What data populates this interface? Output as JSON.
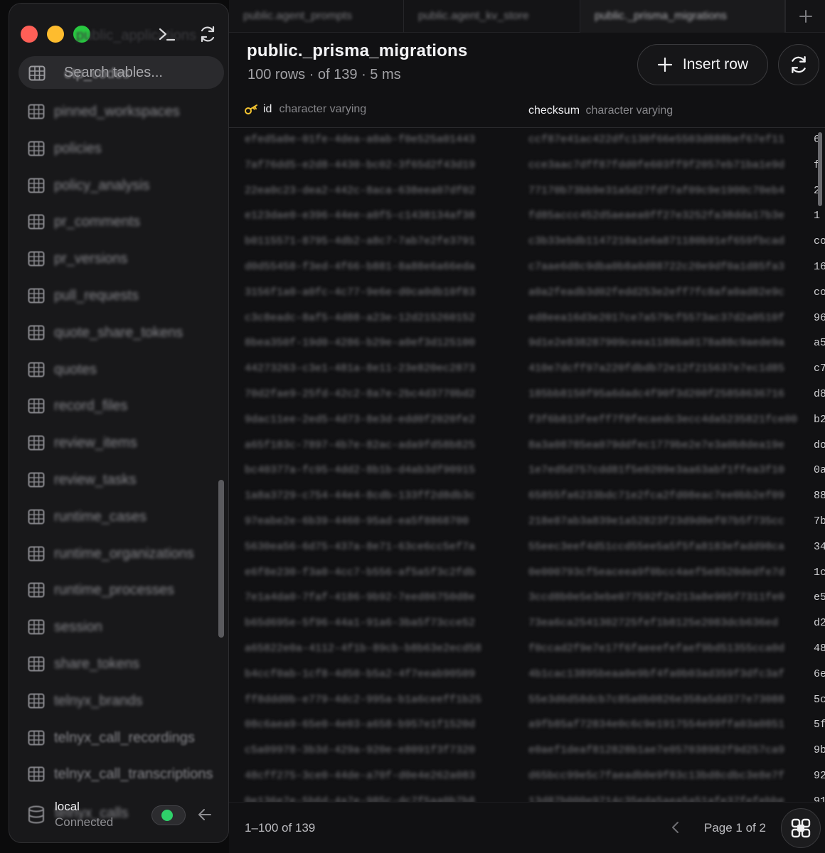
{
  "sidebar": {
    "ghost_header": "public_applications",
    "search": {
      "placeholder": "Search tables...",
      "behind_text": "otp_codes"
    },
    "tables": [
      "pinned_workspaces",
      "policies",
      "policy_analysis",
      "pr_comments",
      "pr_versions",
      "pull_requests",
      "quote_share_tokens",
      "quotes",
      "record_files",
      "review_items",
      "review_tasks",
      "runtime_cases",
      "runtime_organizations",
      "runtime_processes",
      "session",
      "share_tokens",
      "telnyx_brands",
      "telnyx_call_recordings",
      "telnyx_call_transcriptions"
    ],
    "connection": {
      "name": "local",
      "status": "Connected",
      "behind_text": "telnyx_calls"
    }
  },
  "tabs": [
    {
      "label": "public.agent_prompts"
    },
    {
      "label": "public.agent_kv_store"
    },
    {
      "label": "public._prisma_migrations",
      "active": true
    }
  ],
  "table_view": {
    "title": "public._prisma_migrations",
    "subtitle": "100 rows · of 139 · 5 ms",
    "insert_label": "Insert row",
    "columns": [
      {
        "name": "id",
        "type": "character varying",
        "primary_key": true
      },
      {
        "name": "checksum",
        "type": "character varying"
      }
    ],
    "rows": [
      {
        "id": "efed5a0e-01fe-4dea-a0ab-f0e525a01443",
        "checksum": "ccf87e41ac422dfc130f66e5503d888bef67ef11",
        "peek": "6"
      },
      {
        "id": "7af76dd5-e2d8-4430-bc02-3f65d2f43d19",
        "checksum": "cce3aac7dff87fdd0fe603ff9f2057eb71ba1e9d",
        "peek": "f"
      },
      {
        "id": "22ea0c23-dea2-442c-8aca-638eea07df02",
        "checksum": "77170b73bb9e31a5d27fdf7af09c9e1900c70eb4",
        "peek": "2"
      },
      {
        "id": "e123dae0-e396-44ee-a0f5-c1438134af38",
        "checksum": "fd85accc452d5aeaea0ff27e3252fa38dda17b3e",
        "peek": "1"
      },
      {
        "id": "b0115571-8795-4db2-a8c7-7ab7e2fe3791",
        "checksum": "c3b33ebdb1147210a1e6a871180b91ef659fbcad",
        "peek": "co"
      },
      {
        "id": "d0d55458-f3ed-4f66-b881-8a88e6a66eda",
        "checksum": "c7aae6d8c9dba0b8a0d88722c20e9df0a1d85fa3",
        "peek": "16"
      },
      {
        "id": "3156f1a0-a0fc-4c77-9e6e-d0ca0db10f83",
        "checksum": "a0a2feadb3d02fedd253e2eff7fc8afa0ad82e9c",
        "peek": "co"
      },
      {
        "id": "c3c8eadc-8af5-4d88-a23e-12d215260152",
        "checksum": "ed8eea16d3e2017ce7a579cf5573ac37d2a0510f",
        "peek": "96"
      },
      {
        "id": "8bea350f-19d0-4286-b29e-a0ef3d125100",
        "checksum": "9d1e2e838287909ceea1188ba0178a88c9aede9a",
        "peek": "a5"
      },
      {
        "id": "44273263-c3e1-481a-8e11-23e820ec2873",
        "checksum": "410e7dcff97a220fdbdb72e12f215637e7ec1d85",
        "peek": "c7"
      },
      {
        "id": "70d2fae9-25fd-42c2-8a7e-2bc4d3770bd2",
        "checksum": "185bb8150f95a6dadc4f90f3d200f25858636716",
        "peek": "d8"
      },
      {
        "id": "9dac11ee-2ed5-4d73-8e3d-edd0f2020fe2",
        "checksum": "f3f6b813feeff7f0fecaedc3ecc4da5235821fce00",
        "peek": "b2"
      },
      {
        "id": "a65f183c-7897-4b7e-82ac-ada9fd58b825",
        "checksum": "8a3a08785ea079ddfec1779be2e7e3a0b8dea19e",
        "peek": "do"
      },
      {
        "id": "bc40377a-fc95-4dd2-8b1b-d4ab3df90915",
        "checksum": "1e7ed5d757cdd81f5e0209e3aa63abf1ffea3f10",
        "peek": "0a"
      },
      {
        "id": "1a8a3729-c754-44e4-8cdb-133ff2d8db3c",
        "checksum": "65855fa6233bdc71e2fca2fd08eac7ee0bb2ef09",
        "peek": "88"
      },
      {
        "id": "97eabe2e-6b39-4460-95ad-ea5f8868700",
        "checksum": "218e87ab3a839e1a52823f23d9d0ef07b5f735cc",
        "peek": "7b"
      },
      {
        "id": "5630ea56-6d75-437a-8e71-63ce6cc5ef7a",
        "checksum": "55eec3eef4d51ccd55ee5a5f5fa8183efadd98ca",
        "peek": "34"
      },
      {
        "id": "e6f8e230-f3a0-4cc7-b556-af5a5f3c2fdb",
        "checksum": "0e000793cf5eaceea9f0bcc4aef5e8520dedfe7d",
        "peek": "1c"
      },
      {
        "id": "7e1a4da0-7faf-4186-9b92-7eed86750d8e",
        "checksum": "3ccd8b0e5e3ebe077592f2e213a8e905f7311fe0",
        "peek": "e5"
      },
      {
        "id": "b65d695e-5f96-44a1-91a6-3ba5f73cce52",
        "checksum": "73ea6ca2541302725fef1b8125e2083dcb636ed",
        "peek": "d2"
      },
      {
        "id": "a65822e0a-4112-4f1b-89cb-b8b63e2ecd58",
        "checksum": "f0ccad2f9e7e17f6faeeefefaef9bd51355cca0d",
        "peek": "48"
      },
      {
        "id": "b4ccf0ab-1cf8-4d50-b5a2-4f7eeab90509",
        "checksum": "4b1cac13895beaa0e9bf4fa0b03ad359f3dfc3af",
        "peek": "6e"
      },
      {
        "id": "ff8ddd0b-e779-4dc2-995a-b1a6ceeff1b25",
        "checksum": "55e3d6d58dcb7c85a0b0826e358a5dd377e73088",
        "peek": "5c"
      },
      {
        "id": "08c6aea9-65e0-4e03-a658-b957e1f1520d",
        "checksum": "a9fb85af72834e0c6c9e1917554e99ffa03a0851",
        "peek": "5f"
      },
      {
        "id": "c5a09978-3b3d-429a-920e-e8091f3f7320",
        "checksum": "e0aef1deaf812828b1ae7e057038982f9d257ca9",
        "peek": "9b"
      },
      {
        "id": "48cff275-3ce0-44de-a70f-d0e4e262a083",
        "checksum": "d65bcc99e5c7faeadb0e9f83c13bd8cdbc3e8e7f",
        "peek": "92"
      },
      {
        "id": "0e136e7e-5b6d-4a7e-985c-dc7f5aa0b7b8",
        "checksum": "13d87b000e9714c35eda5aea5a51afe37fefebbe",
        "peek": "91"
      }
    ]
  },
  "footer": {
    "range": "1–100 of 139",
    "page": "Page 1 of 2"
  }
}
